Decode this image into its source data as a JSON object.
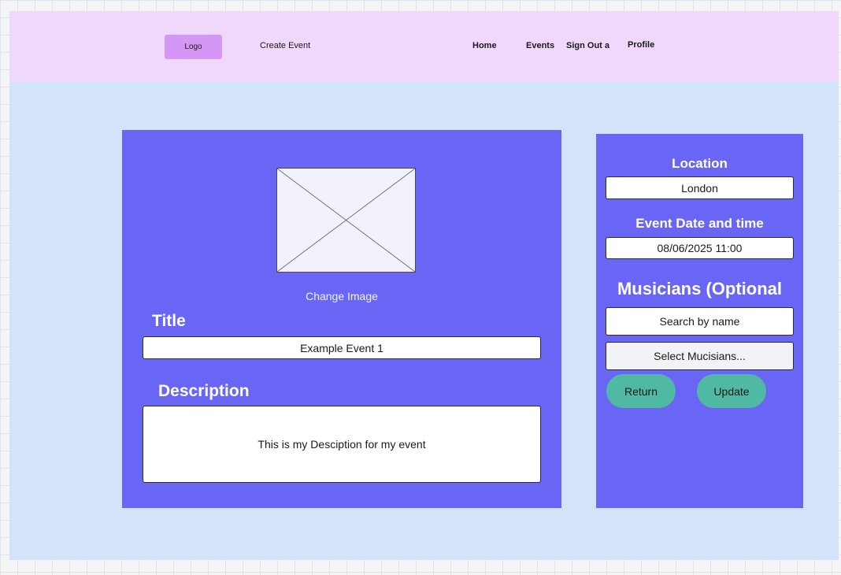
{
  "header": {
    "logo": "Logo",
    "page_title": "Create Event",
    "nav": {
      "home": "Home",
      "events": "Events",
      "sign_out": "Sign Out a",
      "profile": "Profile"
    }
  },
  "main": {
    "image_icon": "image-placeholder-icon",
    "change_image": "Change Image",
    "title_label": "Title",
    "title_value": "Example Event 1",
    "description_label": "Description",
    "description_value": "This is my Desciption for my event"
  },
  "side": {
    "location_label": "Location",
    "location_value": "London",
    "datetime_label": "Event Date and time",
    "datetime_value": "08/06/2025 11:00",
    "musicians_label": "Musicians (Optional",
    "search_placeholder": "Search by name",
    "select_musicians": "Select Mucisians...",
    "return_label": "Return",
    "update_label": "Update"
  },
  "colors": {
    "canvas": "#d3e3f9",
    "header": "#efd8fb",
    "logo": "#d597f5",
    "panel": "#6966f5",
    "button": "#50b9a3"
  }
}
